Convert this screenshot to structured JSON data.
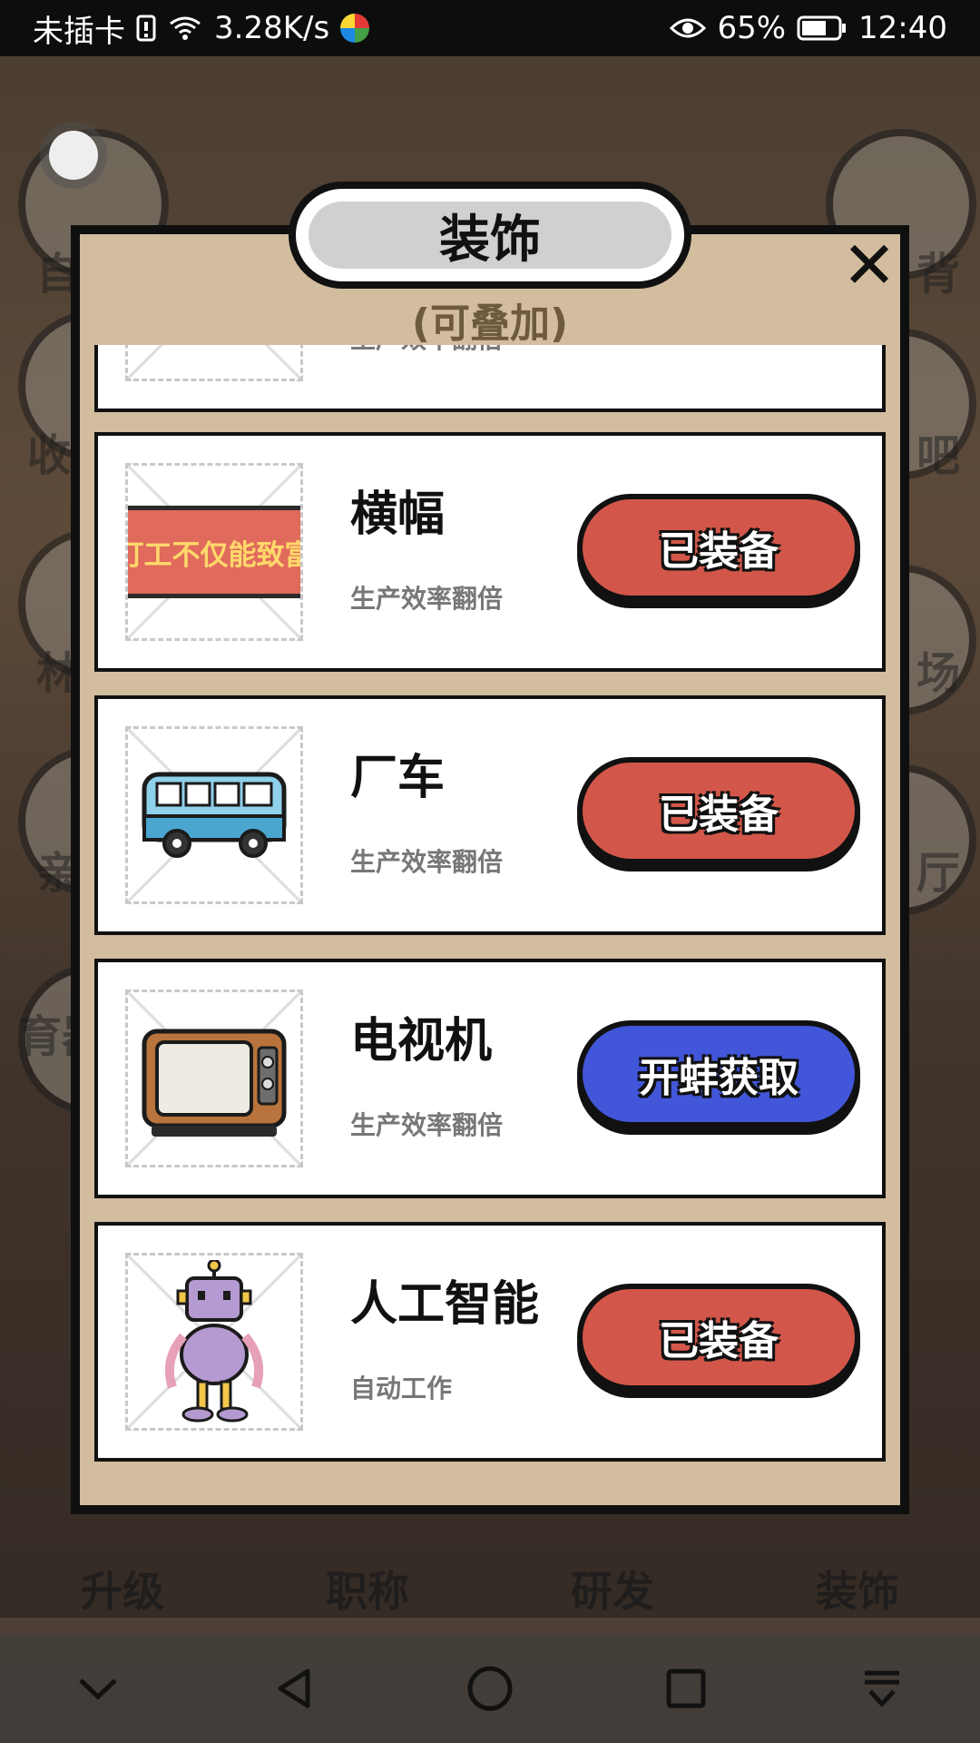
{
  "status_bar": {
    "carrier": "未插卡",
    "speed": "3.28K/s",
    "battery": "65%",
    "time": "12:40"
  },
  "background": {
    "labels_left": [
      "自",
      "收",
      "林",
      "亲",
      "育器"
    ],
    "labels_right": [
      "背",
      "吧",
      "场",
      "厅"
    ]
  },
  "modal": {
    "title": "装饰",
    "subtitle": "(可叠加)",
    "close_symbol": "✕",
    "partial_item": {
      "desc": "生产效率翻倍"
    },
    "items": [
      {
        "name": "横幅",
        "desc": "生产效率翻倍",
        "action": "已装备",
        "action_color": "#d2574a",
        "banner_text": "打工不仅能致富"
      },
      {
        "name": "厂车",
        "desc": "生产效率翻倍",
        "action": "已装备",
        "action_color": "#d2574a"
      },
      {
        "name": "电视机",
        "desc": "生产效率翻倍",
        "action": "开蚌获取",
        "action_color": "#4156d8"
      },
      {
        "name": "人工智能",
        "desc": "自动工作",
        "action": "已装备",
        "action_color": "#d2574a"
      }
    ]
  },
  "tabbar": {
    "tabs": [
      "升级",
      "职称",
      "研发",
      "装饰"
    ]
  },
  "navbar": {
    "buttons": [
      "collapse-icon",
      "back-icon",
      "home-icon",
      "recents-icon",
      "download-icon"
    ]
  }
}
